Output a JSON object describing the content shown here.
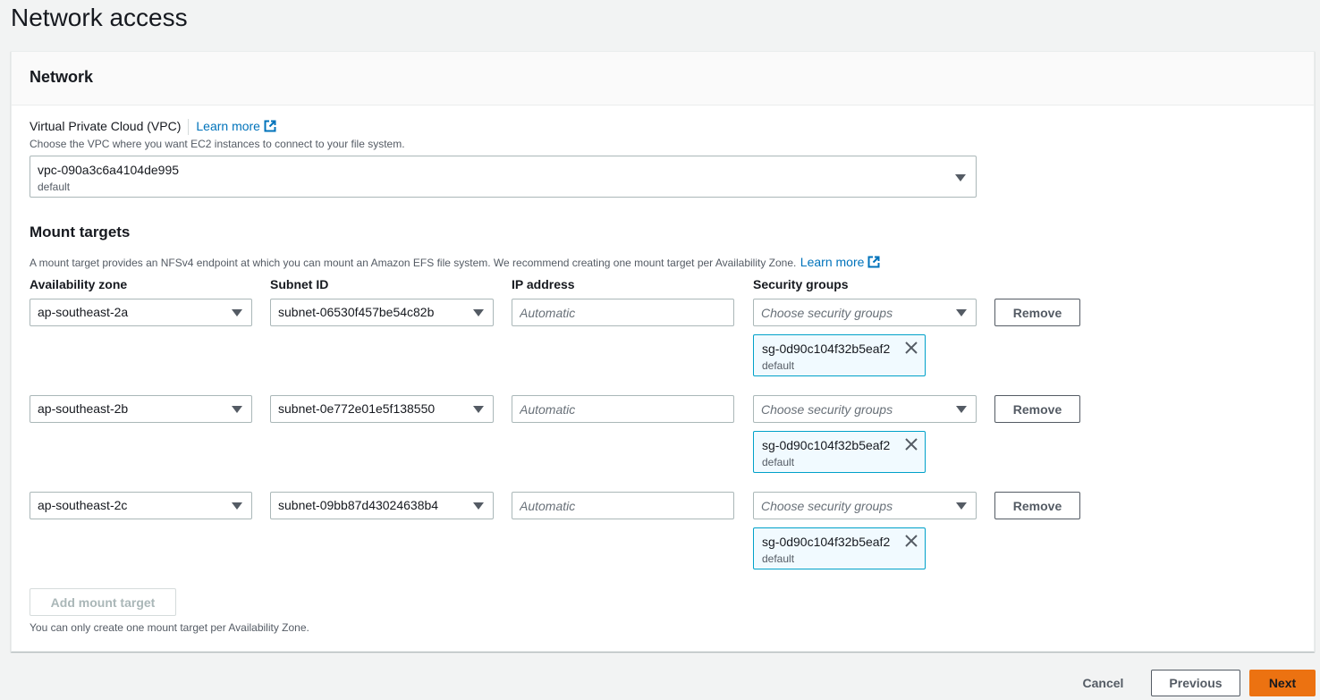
{
  "page": {
    "title": "Network access"
  },
  "network": {
    "header": "Network",
    "vpc": {
      "label": "Virtual Private Cloud (VPC)",
      "learn_more": "Learn more",
      "description": "Choose the VPC where you want EC2 instances to connect to your file system.",
      "value": "vpc-090a3c6a4104de995",
      "sublabel": "default"
    },
    "mount_targets": {
      "title": "Mount targets",
      "description": "A mount target provides an NFSv4 endpoint at which you can mount an Amazon EFS file system. We recommend creating one mount target per Availability Zone.",
      "learn_more": "Learn more",
      "columns": {
        "az": "Availability zone",
        "subnet": "Subnet ID",
        "ip": "IP address",
        "sg": "Security groups"
      },
      "rows": [
        {
          "az": "ap-southeast-2a",
          "subnet": "subnet-06530f457be54c82b",
          "ip_placeholder": "Automatic",
          "sg_placeholder": "Choose security groups",
          "token": {
            "name": "sg-0d90c104f32b5eaf2",
            "sub": "default"
          },
          "remove": "Remove"
        },
        {
          "az": "ap-southeast-2b",
          "subnet": "subnet-0e772e01e5f138550",
          "ip_placeholder": "Automatic",
          "sg_placeholder": "Choose security groups",
          "token": {
            "name": "sg-0d90c104f32b5eaf2",
            "sub": "default"
          },
          "remove": "Remove"
        },
        {
          "az": "ap-southeast-2c",
          "subnet": "subnet-09bb87d43024638b4",
          "ip_placeholder": "Automatic",
          "sg_placeholder": "Choose security groups",
          "token": {
            "name": "sg-0d90c104f32b5eaf2",
            "sub": "default"
          },
          "remove": "Remove"
        }
      ],
      "add_button": "Add mount target",
      "footer_note": "You can only create one mount target per Availability Zone."
    }
  },
  "footer": {
    "cancel": "Cancel",
    "previous": "Previous",
    "next": "Next"
  },
  "icons": {
    "external_link": "external-link-icon",
    "dropdown": "caret-down-icon",
    "dismiss": "close-icon"
  },
  "colors": {
    "link": "#0073bb",
    "primary": "#ec7211",
    "token_border": "#00a1c9",
    "token_bg": "#f1faff"
  }
}
